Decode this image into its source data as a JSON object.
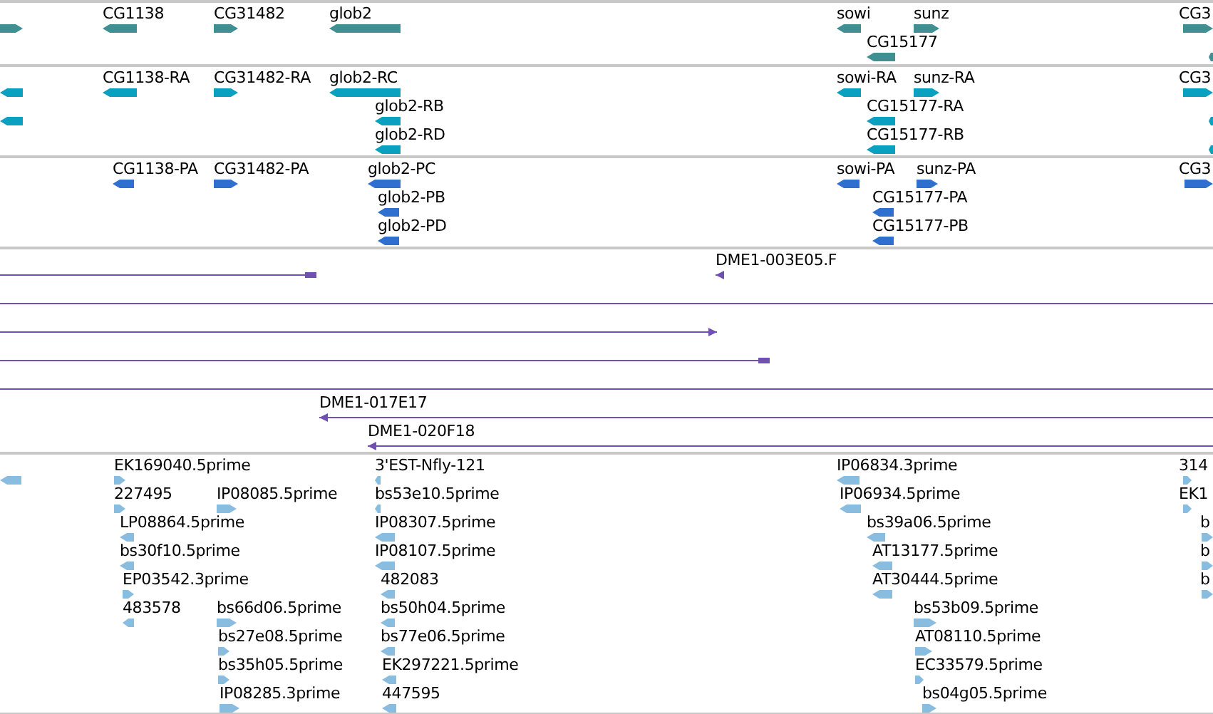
{
  "tracks": [
    {
      "kind": "gene",
      "features": [
        {
          "reverse": false
        },
        {
          "label": "CG1138",
          "reverse": true
        },
        {
          "label": "CG31482",
          "reverse": false
        },
        {
          "label": "glob2",
          "reverse": true
        },
        {
          "label": "sowi",
          "reverse": true
        },
        {
          "label": "sunz",
          "reverse": false
        },
        {
          "label": "CG3",
          "reverse": false
        },
        {
          "label": "CG15177",
          "reverse": true
        },
        {
          "reverse": true
        }
      ]
    },
    {
      "kind": "transcript",
      "features": [
        {
          "reverse": true
        },
        {
          "label": "CG1138-RA",
          "reverse": true
        },
        {
          "label": "CG31482-RA",
          "reverse": false
        },
        {
          "label": "glob2-RC",
          "reverse": true
        },
        {
          "label": "sowi-RA",
          "reverse": true
        },
        {
          "label": "sunz-RA",
          "reverse": false
        },
        {
          "label": "CG3",
          "reverse": false
        },
        {
          "reverse": true
        },
        {
          "label": "glob2-RB",
          "reverse": true
        },
        {
          "label": "CG15177-RA",
          "reverse": true
        },
        {
          "reverse": true
        },
        {
          "label": "glob2-RD",
          "reverse": true
        },
        {
          "label": "CG15177-RB",
          "reverse": true
        },
        {
          "reverse": true
        }
      ]
    },
    {
      "kind": "protein",
      "features": [
        {
          "label": "CG1138-PA",
          "reverse": true
        },
        {
          "label": "CG31482-PA",
          "reverse": false
        },
        {
          "label": "glob2-PC",
          "reverse": true
        },
        {
          "label": "sowi-PA",
          "reverse": true
        },
        {
          "label": "sunz-PA",
          "reverse": false
        },
        {
          "label": "CG3",
          "reverse": false
        },
        {
          "label": "glob2-PB",
          "reverse": true
        },
        {
          "label": "CG15177-PA",
          "reverse": true
        },
        {
          "label": "glob2-PD",
          "reverse": true
        },
        {
          "label": "CG15177-PB",
          "reverse": true
        }
      ]
    },
    {
      "kind": "clone",
      "features": [
        {
          "kind": "capped"
        },
        {
          "label": "DME1-003E05.F",
          "kind": "arrow",
          "reverse": true
        },
        {
          "kind": "plain"
        },
        {
          "kind": "arrow",
          "reverse": false
        },
        {
          "kind": "capped"
        },
        {
          "kind": "plain"
        },
        {
          "label": "DME1-017E17",
          "kind": "arrow",
          "reverse": true
        },
        {
          "label": "DME1-020F18",
          "kind": "arrow",
          "reverse": true
        }
      ]
    },
    {
      "kind": "est",
      "features": [
        {
          "reverse": true
        },
        {
          "label": "EK169040.5prime",
          "reverse": false
        },
        {
          "label": "3'EST-Nfly-121",
          "reverse": true
        },
        {
          "label": "IP06834.3prime",
          "reverse": true
        },
        {
          "label": "314",
          "reverse": false
        },
        {
          "label": "227495",
          "reverse": false
        },
        {
          "label": "IP08085.5prime",
          "reverse": false
        },
        {
          "label": "bs53e10.5prime",
          "reverse": true
        },
        {
          "label": "IP06934.5prime",
          "reverse": true
        },
        {
          "label": "EK1",
          "reverse": false
        },
        {
          "label": "LP08864.5prime",
          "reverse": true
        },
        {
          "label": "IP08307.5prime",
          "reverse": true
        },
        {
          "label": "bs39a06.5prime",
          "reverse": true
        },
        {
          "label": "b",
          "reverse": false
        },
        {
          "label": "bs30f10.5prime",
          "reverse": true
        },
        {
          "label": "IP08107.5prime",
          "reverse": true
        },
        {
          "label": "AT13177.5prime",
          "reverse": true
        },
        {
          "label": "b",
          "reverse": false
        },
        {
          "label": "EP03542.3prime",
          "reverse": false
        },
        {
          "label": "482083",
          "reverse": true
        },
        {
          "label": "AT30444.5prime",
          "reverse": true
        },
        {
          "label": "b",
          "reverse": false
        },
        {
          "label": "483578",
          "reverse": true
        },
        {
          "label": "bs66d06.5prime",
          "reverse": false
        },
        {
          "label": "bs50h04.5prime",
          "reverse": true
        },
        {
          "label": "bs53b09.5prime",
          "reverse": false
        },
        {
          "label": "bs27e08.5prime",
          "reverse": false
        },
        {
          "label": "bs77e06.5prime",
          "reverse": true
        },
        {
          "label": "AT08110.5prime",
          "reverse": false
        },
        {
          "label": "bs35h05.5prime",
          "reverse": false
        },
        {
          "label": "EK297221.5prime",
          "reverse": true
        },
        {
          "label": "EC33579.5prime",
          "reverse": false
        },
        {
          "label": "IP08285.3prime",
          "reverse": false
        },
        {
          "label": "447595",
          "reverse": true
        },
        {
          "label": "bs04g05.5prime",
          "reverse": false
        }
      ]
    }
  ]
}
